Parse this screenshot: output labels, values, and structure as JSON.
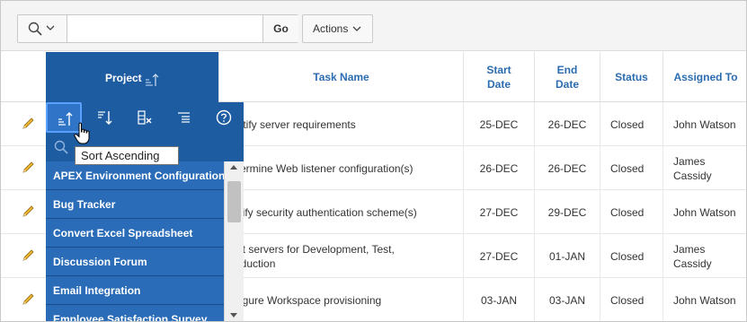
{
  "toolbar": {
    "search_placeholder": "",
    "go_label": "Go",
    "actions_label": "Actions"
  },
  "table": {
    "headers": {
      "project": "Project",
      "task_name": "Task Name",
      "start_date_line1": "Start",
      "start_date_line2": "Date",
      "end_date_line1": "End",
      "end_date_line2": "Date",
      "status": "Status",
      "assigned_to": "Assigned To"
    },
    "rows": [
      {
        "task": "entify server requirements",
        "start": "25-DEC",
        "end": "26-DEC",
        "status": "Closed",
        "assigned_line1": "John Watson",
        "assigned_line2": ""
      },
      {
        "task": "etermine Web listener configuration(s)",
        "start": "26-DEC",
        "end": "26-DEC",
        "status": "Closed",
        "assigned_line1": "James",
        "assigned_line2": "Cassidy"
      },
      {
        "task": "ecify security authentication scheme(s)",
        "start": "27-DEC",
        "end": "29-DEC",
        "status": "Closed",
        "assigned_line1": "John Watson",
        "assigned_line2": ""
      },
      {
        "task_line1": "ect servers for Development, Test,",
        "task_line2": "roduction",
        "start": "27-DEC",
        "end": "01-JAN",
        "status": "Closed",
        "assigned_line1": "James",
        "assigned_line2": "Cassidy"
      },
      {
        "task": "nfigure Workspace provisioning",
        "start": "03-JAN",
        "end": "03-JAN",
        "status": "Closed",
        "assigned_line1": "John Watson",
        "assigned_line2": ""
      }
    ]
  },
  "popup": {
    "tooltip": "Sort Ascending",
    "items": [
      "APEX Environment Configuration",
      "Bug Tracker",
      "Convert Excel Spreadsheet",
      "Discussion Forum",
      "Email Integration",
      "Employee Satisfaction Survey"
    ]
  },
  "colors": {
    "accent": "#1e5ca2",
    "header_text": "#2b6cb0"
  }
}
